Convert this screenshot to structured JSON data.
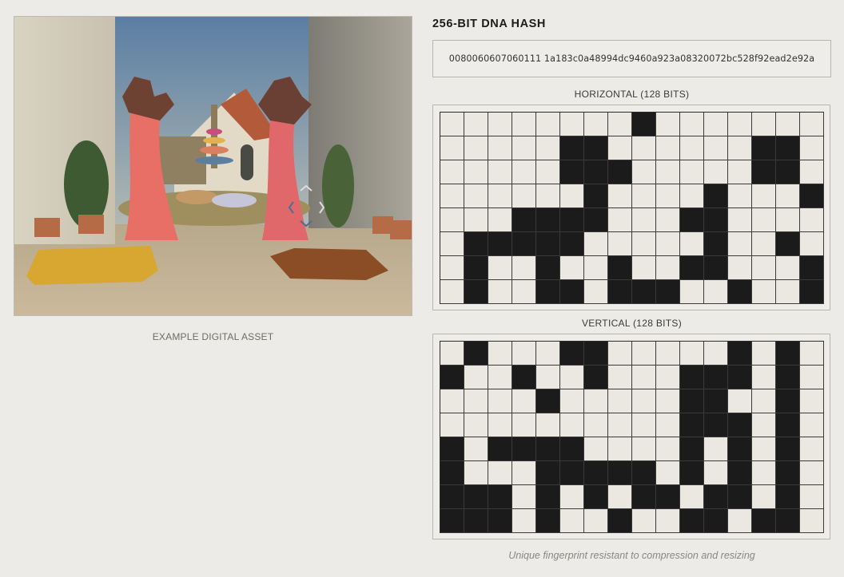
{
  "asset": {
    "caption": "EXAMPLE DIGITAL ASSET"
  },
  "hash": {
    "title": "256-BIT DNA HASH",
    "value": "0080060607060111 1a183c0a48994dc9460a923a08320072bc528f92ead2e92a"
  },
  "horizontal": {
    "label": "HORIZONTAL (128 BITS)",
    "rows": [
      "0000000010000000",
      "0000011000000110",
      "0000011100000110",
      "0000001000010001",
      "0003311000110000",
      "0111110000010010",
      "0100100100110001",
      "0100110111001001"
    ]
  },
  "vertical": {
    "label": "VERTICAL (128 BITS)",
    "rows": [
      "0100011000001010",
      "1001001000111010",
      "0000100000110010",
      "0000000000111010",
      "1011110000101010",
      "1000111110101010",
      "1110101011011010",
      "1110100100110110"
    ]
  },
  "tagline": "Unique fingerprint resistant to compression and resizing",
  "colors": {
    "background": "#ecebe7",
    "cell_on": "#1b1b1b",
    "cell_off": "#ebe8e2"
  }
}
